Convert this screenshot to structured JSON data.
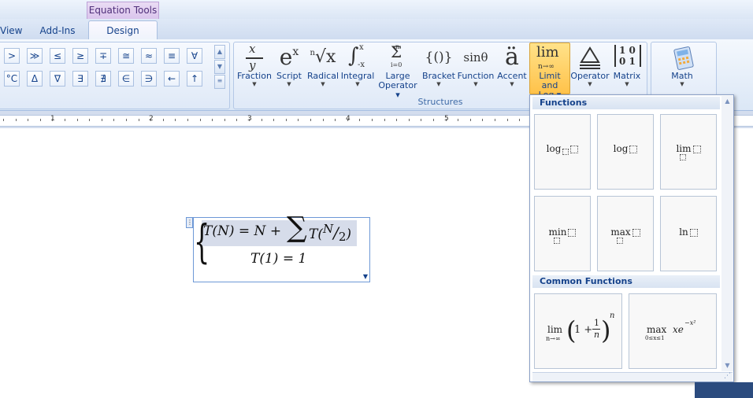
{
  "ribbon": {
    "context_tab": "Equation Tools",
    "tabs": [
      "View",
      "Add-Ins",
      "Design"
    ],
    "symbols_row1": [
      ">",
      "≫",
      "≤",
      "≥",
      "∓",
      "≅",
      "≈",
      "≡",
      "∀"
    ],
    "symbols_row2": [
      "°C",
      "Δ",
      "∇",
      "∃",
      "∄",
      "∈",
      "∋",
      "←",
      "↑"
    ],
    "structures": [
      {
        "label": "Fraction",
        "icon": "fraction-icon"
      },
      {
        "label": "Script",
        "icon": "script-icon"
      },
      {
        "label": "Radical",
        "icon": "radical-icon"
      },
      {
        "label": "Integral",
        "icon": "integral-icon"
      },
      {
        "label": "Large Operator",
        "label_l1": "Large",
        "label_l2": "Operator",
        "icon": "large-operator-icon"
      },
      {
        "label": "Bracket",
        "icon": "bracket-icon"
      },
      {
        "label": "Function",
        "icon": "function-icon"
      },
      {
        "label": "Accent",
        "icon": "accent-icon"
      },
      {
        "label": "Limit and Log",
        "label_l1": "Limit and",
        "label_l2": "Log",
        "icon": "limit-log-icon"
      },
      {
        "label": "Operator",
        "icon": "operator-icon"
      },
      {
        "label": "Matrix",
        "icon": "matrix-icon"
      }
    ],
    "structures_group_label": "Structures",
    "math_button_label": "Math",
    "icon_text": {
      "fraction_num": "x",
      "fraction_den": "y",
      "script_base": "e",
      "script_sup": "x",
      "radical_index": "n",
      "radical_sign": "√x",
      "integral_upper": "x",
      "integral_sign": "∫",
      "integral_lower": "-x",
      "large_top": "n",
      "large_sigma": "Σ",
      "large_bottom": "i=0",
      "bracket": "{()}",
      "function": "sinθ",
      "accent": "ä",
      "lim_word": "lim",
      "lim_sub": "n→∞",
      "matrix_row1": "1 0",
      "matrix_row2": "0 1"
    }
  },
  "ruler": {
    "numbers": [
      "1",
      "2",
      "3",
      "4",
      "5"
    ]
  },
  "equation": {
    "handle": "⋮",
    "line1_lhs": "T(N)",
    "line1_eq": " = N + ",
    "sum": "∑",
    "line1_T": "T(",
    "line1_N": "N",
    "line1_slash": "/",
    "line1_2": "2",
    "line1_close": ")",
    "line2": "T(1) = 1",
    "brace": "{",
    "dropdown": "▼"
  },
  "gallery": {
    "functions_header": "Functions",
    "common_header": "Common Functions",
    "cells": [
      {
        "name": "log-sub",
        "text": "log"
      },
      {
        "name": "log",
        "text": "log"
      },
      {
        "name": "lim",
        "text": "lim"
      },
      {
        "name": "min",
        "text": "min"
      },
      {
        "name": "max",
        "text": "max"
      },
      {
        "name": "ln",
        "text": "ln"
      }
    ],
    "common": {
      "lim_word": "lim",
      "lim_sub": "n→∞",
      "lim_one": "1 +",
      "lim_frac_num": "1",
      "lim_frac_den": "n",
      "lim_exp": "n",
      "max_word": "max",
      "max_sub": "0≤x≤1",
      "max_expr": "xe",
      "max_exp": "−x²"
    },
    "scroll_up": "▲",
    "scroll_down": "▼",
    "grip": "⋰"
  }
}
